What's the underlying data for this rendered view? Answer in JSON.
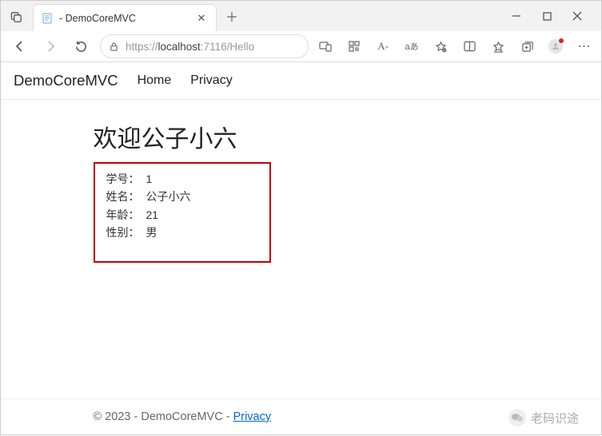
{
  "browser": {
    "tab_title": " - DemoCoreMVC",
    "url_prefix": "https://",
    "url_host": "localhost",
    "url_port_path": ":7116/Hello"
  },
  "header": {
    "brand": "DemoCoreMVC",
    "nav": {
      "home": "Home",
      "privacy": "Privacy"
    }
  },
  "content": {
    "title": "欢迎公子小六",
    "labels": {
      "id": "学号：",
      "name": "姓名：",
      "age": "年龄：",
      "gender": "性别："
    },
    "values": {
      "id": "1",
      "name": "公子小六",
      "age": "21",
      "gender": "男"
    }
  },
  "footer": {
    "copyright": "© 2023 - DemoCoreMVC - ",
    "privacy_link": "Privacy"
  },
  "watermark": {
    "text": "老码识途"
  }
}
